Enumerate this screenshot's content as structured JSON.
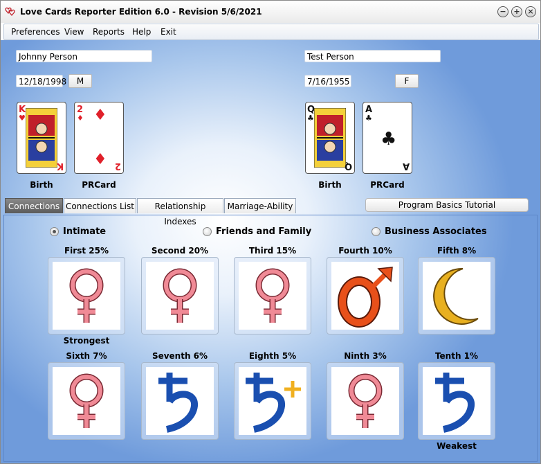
{
  "window": {
    "title": "Love Cards Reporter Edition 6.0  - Revision 5/6/2021"
  },
  "menu": [
    "Preferences",
    "View",
    "Reports",
    "Help",
    "Exit"
  ],
  "person1": {
    "name": "Johnny Person",
    "date": "12/18/1998",
    "gender": "M",
    "cards": [
      {
        "rank": "K",
        "suit": "♥",
        "label": "Birth"
      },
      {
        "rank": "2",
        "suit": "♦",
        "label": "PRCard"
      }
    ]
  },
  "person2": {
    "name": "Test Person",
    "date": "7/16/1955",
    "gender": "F",
    "cards": [
      {
        "rank": "Q",
        "suit": "♣",
        "label": "Birth"
      },
      {
        "rank": "A",
        "suit": "♣",
        "label": "PRCard"
      }
    ]
  },
  "tabs": [
    "Connections",
    "Connections List",
    "Relationship Indexes",
    "Marriage-Ability"
  ],
  "tutorial_button": "Program Basics Tutorial",
  "radios": [
    {
      "label": "Intimate",
      "checked": true
    },
    {
      "label": "Friends and Family",
      "checked": false
    },
    {
      "label": "Business Associates",
      "checked": false
    }
  ],
  "connections": [
    {
      "label": "First 25%",
      "symbol": "venus-icon",
      "sub": "Strongest"
    },
    {
      "label": "Second 20%",
      "symbol": "venus-icon",
      "sub": ""
    },
    {
      "label": "Third 15%",
      "symbol": "venus-icon",
      "sub": ""
    },
    {
      "label": "Fourth 10%",
      "symbol": "mars-icon",
      "sub": ""
    },
    {
      "label": "Fifth 8%",
      "symbol": "moon-icon",
      "sub": ""
    },
    {
      "label": "Sixth 7%",
      "symbol": "venus-icon",
      "sub": ""
    },
    {
      "label": "Seventh 6%",
      "symbol": "saturn-icon",
      "sub": ""
    },
    {
      "label": "Eighth 5%",
      "symbol": "saturn-plus-icon",
      "sub": ""
    },
    {
      "label": "Ninth 3%",
      "symbol": "venus-icon",
      "sub": ""
    },
    {
      "label": "Tenth 1%",
      "symbol": "saturn-icon",
      "sub": "Weakest"
    }
  ],
  "colors": {
    "red_suit": "#e0202a",
    "black_suit": "#111111",
    "venus": "#f08a96",
    "mars": "#e8501a",
    "moon": "#e8b020",
    "saturn": "#1a4fb0",
    "plus": "#f0b020"
  }
}
